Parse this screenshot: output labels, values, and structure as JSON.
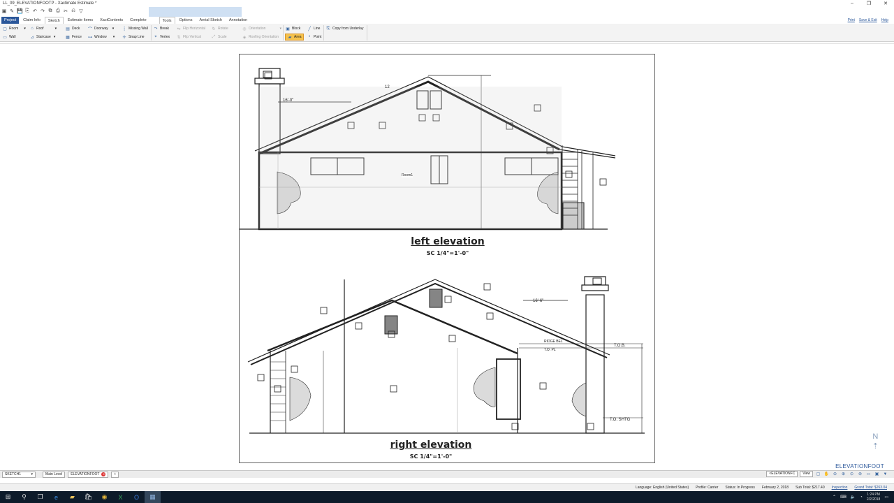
{
  "window": {
    "title": "LL_09_ELEVATIONFOOTP - Xactimate Estimate *",
    "minimize": "–",
    "maximize": "❐",
    "close": "✕"
  },
  "qat": [
    "▣",
    "✎",
    "💾",
    "⎘",
    "↶",
    "↷",
    "⧉",
    "⎙",
    "✂",
    "⎌",
    "▽"
  ],
  "tabs": [
    {
      "label": "Project",
      "state": "active"
    },
    {
      "label": "Claim Info"
    },
    {
      "label": "Sketch",
      "state": "sel"
    },
    {
      "label": "Estimate Items"
    },
    {
      "label": "XactContents"
    },
    {
      "label": "Complete"
    },
    {
      "label": "Tools",
      "state": "sel"
    },
    {
      "label": "Options"
    },
    {
      "label": "Aerial Sketch"
    },
    {
      "label": "Annotation"
    }
  ],
  "toplinks": [
    "Print",
    "Save & Exit",
    "Help"
  ],
  "ribbon": {
    "g1": [
      {
        "label": "Room",
        "icon": "▢"
      },
      {
        "label": "Wall",
        "icon": "▭"
      }
    ],
    "g2": [
      {
        "label": "Roof",
        "icon": "⌂"
      },
      {
        "label": "Staircase",
        "icon": "⊿"
      }
    ],
    "g3": [
      {
        "label": "Deck",
        "icon": "▤"
      },
      {
        "label": "Fence",
        "icon": "▦"
      }
    ],
    "g4": [
      {
        "label": "Doorway",
        "icon": "⌒"
      },
      {
        "label": "Window",
        "icon": "⊶"
      }
    ],
    "g5": [
      {
        "label": "Missing Wall",
        "icon": "┆"
      },
      {
        "label": "Snap Line",
        "icon": "✛"
      }
    ],
    "g6": [
      {
        "label": "Break",
        "icon": "⤳"
      },
      {
        "label": "Vertex",
        "icon": "⌖"
      }
    ],
    "g7": [
      {
        "label": "Flip Horizontal",
        "icon": "⇋"
      },
      {
        "label": "Flip Vertical",
        "icon": "⇅"
      }
    ],
    "g8": [
      {
        "label": "Rotate",
        "icon": "↻"
      },
      {
        "label": "Scale",
        "icon": "⤢"
      }
    ],
    "g9": [
      {
        "label": "Orientation",
        "icon": "◎"
      },
      {
        "label": "Roofing Orientation",
        "icon": "◈"
      }
    ],
    "g10": [
      {
        "label": "Block",
        "icon": "▣"
      },
      {
        "label": "Area",
        "icon": "▰"
      }
    ],
    "g11": [
      {
        "label": "Line",
        "icon": "╱"
      },
      {
        "label": "Point",
        "icon": "•"
      }
    ],
    "g12": [
      {
        "label": "Copy from Underlay",
        "icon": "⎘"
      }
    ]
  },
  "drawing": {
    "upper_title": "left elevation",
    "upper_scale": "SC 1/4\"=1'-0\"",
    "lower_title": "right elevation",
    "lower_scale": "SC 1/4\"=1'-0\"",
    "room_label": "Room1",
    "dim_upper": "16'-0\"",
    "dim_lower": "16'-6\"",
    "pitch": "12",
    "tob": "T.O.B.",
    "top": "T.O. PL",
    "tos": "T.O. SHTG",
    "ridge": "RIDGE BEL"
  },
  "compass": {
    "n": "N",
    "arrow": "⇡"
  },
  "level_name": "ELEVATIONFOOT",
  "sheettabs": {
    "sketch": "SKETCH1",
    "main": "Main Level",
    "elev": "ELEVATIONFOOT",
    "add": "+"
  },
  "rightctl": {
    "level_dd": "<ELEVATIONFC",
    "view_dd": "View"
  },
  "status": {
    "language": "Language:  English (United States)",
    "profile": "Profile:  Carrier",
    "status": "Status:  In Progress",
    "date": "February 2, 2018",
    "subtotal": "Sub Total: $217.40",
    "inspection": "Inspection",
    "grand": "Grand Total: $263.04"
  },
  "taskbar": {
    "time": "1:24 PM",
    "date": "2/2/2018"
  }
}
